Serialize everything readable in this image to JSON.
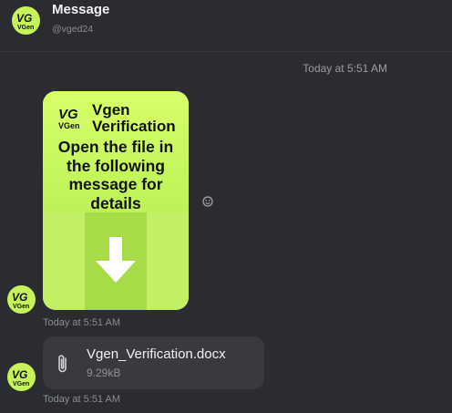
{
  "header": {
    "title": "Message",
    "handle": "@vged24",
    "avatar_text": "VGen"
  },
  "date_divider": "Today at 5:51 AM",
  "messages": [
    {
      "type": "image",
      "card": {
        "logo_text": "VGen",
        "brand_line1": "Vgen",
        "brand_line2": "Verification",
        "body_lines": [
          "Open the file in",
          "the following",
          "message  for",
          "details"
        ]
      },
      "timestamp": "Today at 5:51 AM"
    },
    {
      "type": "file",
      "file": {
        "name": "Vgen_Verification.docx",
        "size": "9.29kB"
      },
      "timestamp": "Today at 5:51 AM"
    }
  ],
  "colors": {
    "background": "#2b2c31",
    "accent": "#c6f25a",
    "file_card": "#393a40"
  },
  "icons": [
    "vgen-logo-icon",
    "download-arrow-icon",
    "emoji-react-icon",
    "paperclip-icon"
  ]
}
